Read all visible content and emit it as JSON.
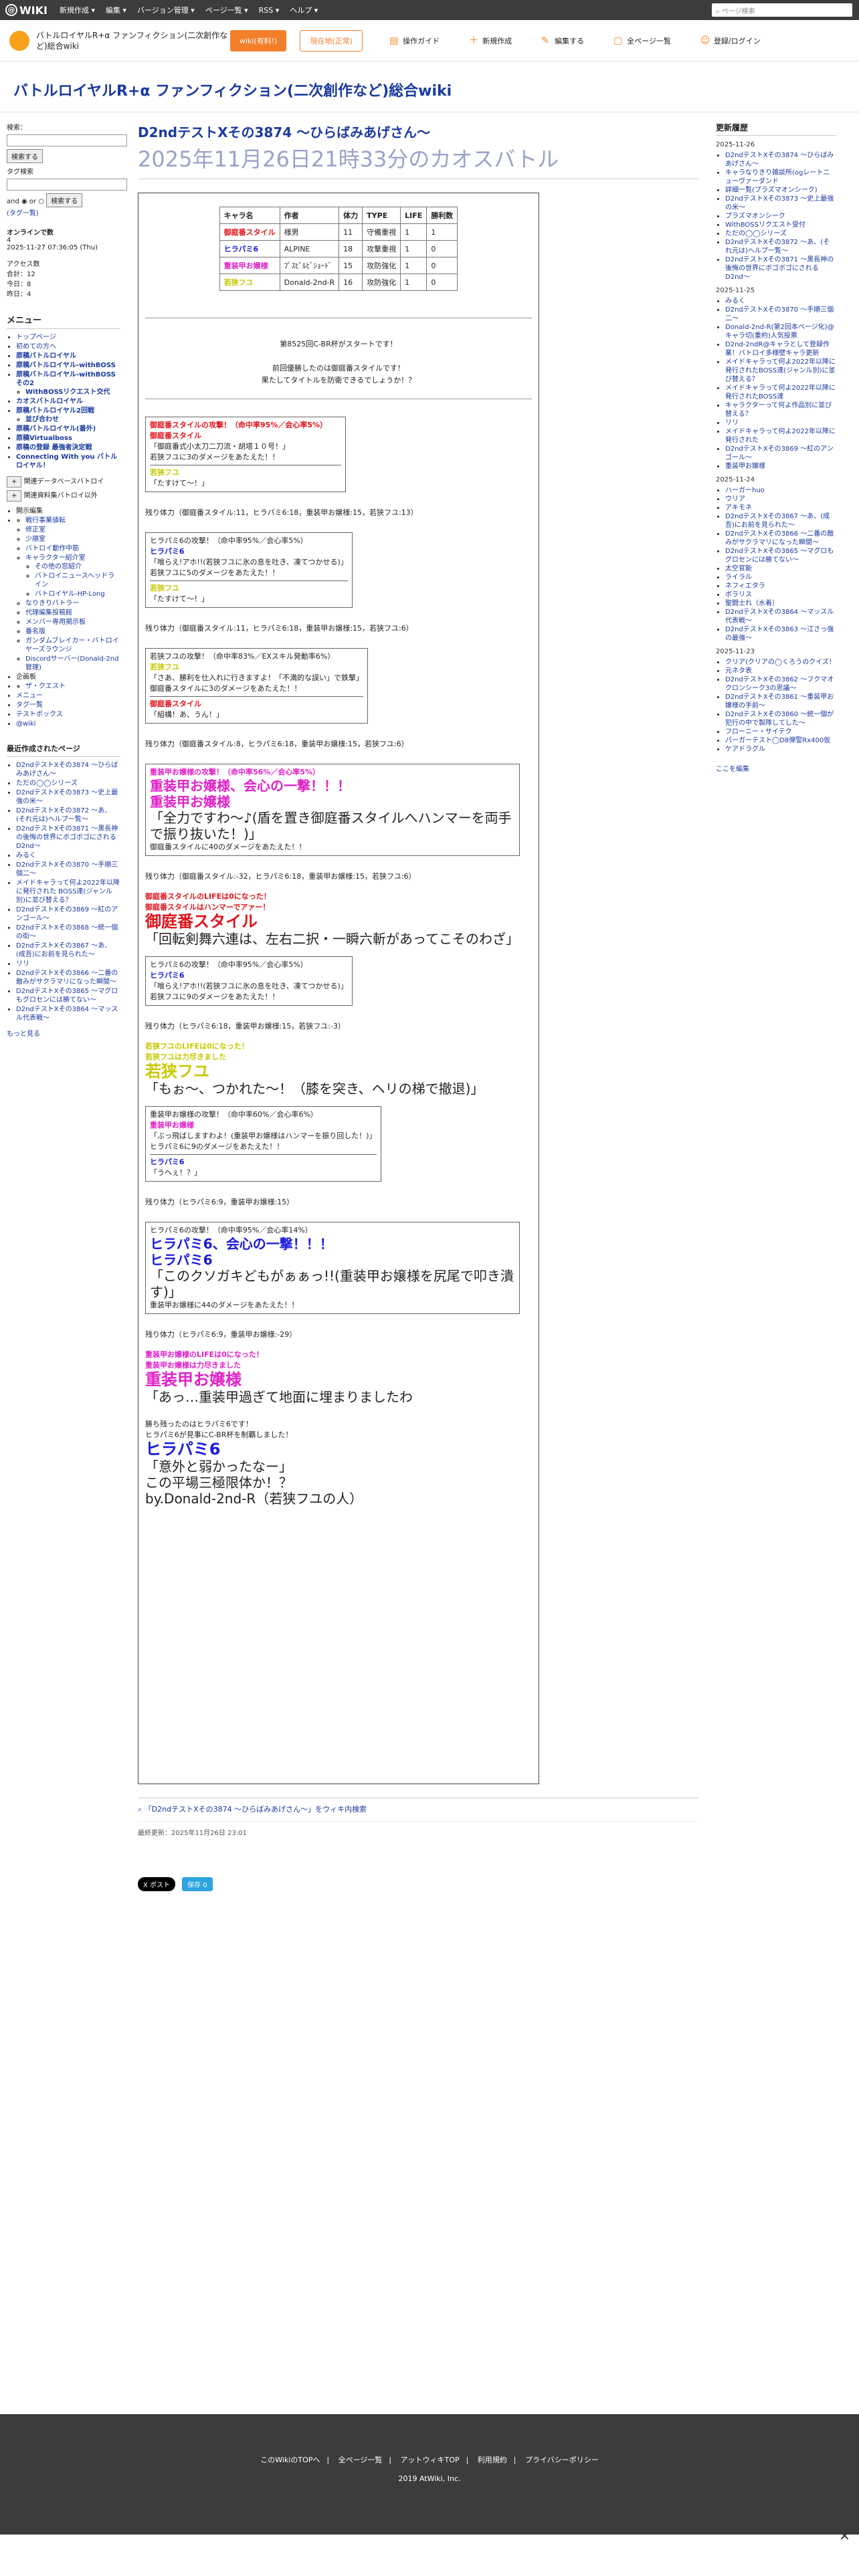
{
  "topbar": {
    "logo": "WIKI",
    "menus": [
      "新規作成 ▾",
      "編集 ▾",
      "バージョン管理 ▾",
      "ページ一覧 ▾",
      "RSS ▾",
      "ヘルプ ▾"
    ],
    "search_placeholder": "ページ検索"
  },
  "header": {
    "wiki_name": "バトルロイヤルR+α ファンフィクション(二次創作など)総合wiki",
    "btn_pro": "wiki(有料!)",
    "btn_free": "現在地(正常)",
    "nav": [
      "操作ガイド",
      "新規作成",
      "編集する",
      "全ページ一覧",
      "登録/ログイン"
    ]
  },
  "site_title": "バトルロイヤルR+α ファンフィクション(二次創作など)総合wiki",
  "left": {
    "search_label": "検索：",
    "search_btn": "検索する",
    "tag_label": "タグ検索",
    "tag_btn": "検索する",
    "and": "and",
    "or": "or",
    "tag_list": "(タグ一覧)",
    "online": "オンラインで数",
    "online_count": "4",
    "date": "2025-11-27 07:36:05 (Thu)",
    "counts": [
      "アクセス数",
      "合計：12",
      "今日：8",
      "昨日：4"
    ],
    "menu_head": "メニュー",
    "menu": [
      "トップページ",
      "初めての方へ",
      "原稿バトルロイヤル",
      "原稿バトルロイヤル-withBOSS",
      "原稿バトルロイヤル-withBOSS その2",
      "WithBOSSリクエスト交代",
      "カオスバトルロイヤル",
      "原稿バトルロイヤル2回戦",
      "並び合わせ",
      "原稿バトルロイヤル(番外)",
      "原稿Virtualboss",
      "原稿の登録 最強者決定戦",
      "Connecting With you バトルロイヤル！"
    ],
    "sub": [
      "関連データベースバトロイ",
      "関連資料集バトロイ以外"
    ],
    "edit_head": "開示編集",
    "edit": [
      "戦行事業値転",
      "修正室",
      "少順室",
      "バトロイ動作中筋",
      "キャラクター紹介室",
      "その他の窓紹介",
      "バトロイニュースヘッドライン",
      "バトロイヤル-HP-Long",
      "なりきりバトラー",
      "代理編集投稿館",
      "メンバー専用掲示板",
      "番名版",
      "ガンダムブレイカー・バトロイヤーズラウンジ",
      "Discordサーバー(Donald-2nd管理)"
    ],
    "other": [
      "企画板",
      "ザ・クエスト",
      "メニュー",
      "タグ一覧",
      "テストボックス",
      "@wiki"
    ],
    "recent_head": "最近作成されたページ",
    "recent": [
      "D2ndテストXその3874 〜ひらばみあげさん〜",
      "ただの◯◯シリーズ",
      "D2ndテストXその3873 〜史上最強の米〜",
      "D2ndテストXその3872 〜あ、(それ元は)ヘルプ一覧〜",
      "D2ndテストXその3871 〜黒長神の後悔の世界にボゴボゴにされる D2nd〜",
      "みるく",
      "D2ndテストXその3870 〜手順三個二〜",
      "メイドキャラって何よ2022年以降に発行された BOSS達(ジャンル別)に並び替える？",
      "D2ndテストXその3869 〜紅のアンゴール〜",
      "D2ndテストXその3868 〜統一個の街〜",
      "D2ndテストXその3867 〜あ、(成吾)にお前を見られた〜",
      "リリ",
      "D2ndテストXその3866 〜二番の敵みがサクラマリになった瞬間〜",
      "D2ndテストXその3865 〜マグロもグロセンには勝てない〜",
      "D2ndテストXその3864 〜マッスル代表戦〜"
    ],
    "more": "もっと見る"
  },
  "main": {
    "title": "D2ndテストXその3874 〜ひらばみあげさん〜",
    "subtitle": "2025年11月26日21時33分のカオスバトル",
    "table": {
      "headers": [
        "キャラ名",
        "作者",
        "体力",
        "TYPE",
        "LIFE",
        "勝利数"
      ],
      "rows": [
        [
          "御庭番スタイル",
          "様男",
          "11",
          "守備重視",
          "1",
          "1"
        ],
        [
          "ヒラパミ6",
          "ALPINE",
          "18",
          "攻撃重視",
          "1",
          "0"
        ],
        [
          "重装甲お嬢様",
          "ﾌﾟｽﾋﾟﾙﾋﾞｼｮｰﾄﾞ",
          "15",
          "攻防強化",
          "1",
          "0"
        ],
        [
          "若狭フユ",
          "Donald-2nd-R",
          "16",
          "攻防強化",
          "1",
          "0"
        ]
      ]
    },
    "intro1": "第8525回C-BR杯がスタートです！",
    "intro2": "前回優勝したのは御庭番スタイルです！",
    "intro3": "果たしてタイトルを防衛できるでしょうか！？",
    "b1": [
      "御庭番スタイルの攻撃！（命中率95%／会心率5%）",
      "御庭番スタイル",
      "「御庭番式小太刀二刀流・胡塔１０号！」",
      "若狭フユに3のダメージをあたえた！！",
      "若狭フユ",
      "「たすけて〜！」"
    ],
    "r1": "残り体力（御庭番スタイル:11，ヒラパミ6:18，重装甲お嬢様:15，若狭フユ:13）",
    "b2": [
      "ヒラパミ6の攻撃！（命中率95%／会心率5%）",
      "ヒラパミ6",
      "「喰らえ!アホ!!(若狭フユに氷の息を吐き、凍てつかせる)」",
      "若狭フユに5のダメージをあたえた！！",
      "若狭フユ",
      "「たすけて〜！」"
    ],
    "r2": "残り体力（御庭番スタイル:11，ヒラパミ6:18，重装甲お嬢様:15，若狭フユ:6）",
    "b3": [
      "若狭フユの攻撃！（命中率83%／EXスキル発動率6%）",
      "若狭フユ",
      "「さあ、勝利を仕入れに行きますよ！「不満的な誤い」で鉄撃」",
      "御庭番スタイルに3のダメージをあたえた！！",
      "御庭番スタイル",
      "「組構！あ、うん！」"
    ],
    "r3": "残り体力（御庭番スタイル:8，ヒラパミ6:18，重装甲お嬢様:15，若狭フユ:6）",
    "b4": [
      "重装甲お嬢様の攻撃！（命中率56%／会心率5%）",
      "重装甲お嬢様、会心の一撃！！！",
      "重装甲お嬢様",
      "「全力ですわ〜♪(盾を置き御庭番スタイルへハンマーを両手で振り抜いた！)」",
      "御庭番スタイルに40のダメージをあたえた！！"
    ],
    "r4": "残り体力（御庭番スタイル:-32，ヒラパミ6:18，重装甲お嬢様:15，若狭フユ:6）",
    "d1": [
      "御庭番スタイルのLIFEは0になった！",
      "御庭番スタイルはハンマーでアァー！",
      "御庭番スタイル",
      "「回転剣舞六連は、左右二択・一瞬六斬があってこそのわざ」"
    ],
    "b5": [
      "ヒラパミ6の攻撃！（命中率95%／会心率5%）",
      "ヒラパミ6",
      "「喰らえ!アホ!!(若狭フユに氷の息を吐き、凍てつかせる)」",
      "若狭フユに9のダメージをあたえた！！"
    ],
    "r5": "残り体力（ヒラパミ6:18，重装甲お嬢様:15，若狭フユ:-3）",
    "d2": [
      "若狭フユのLIFEは0になった！",
      "若狭フユは力尽きました",
      "若狭フユ",
      "「もぉ〜、つかれた〜！（膝を突き、ヘリの梯で撤退)」"
    ],
    "b6": [
      "重装甲お嬢様の攻撃！（命中率60%／会心率6%）",
      "重装甲お嬢様",
      "「ぶっ飛ばしますわよ！(重装甲お嬢様はハンマーを振り回した！)」",
      "ヒラパミ6に9のダメージをあたえた！！",
      "ヒラパミ6",
      "「うへぇ！？」"
    ],
    "r6": "残り体力（ヒラパミ6:9，重装甲お嬢様:15）",
    "b7": [
      "ヒラパミ6の攻撃！（命中率95%／会心率14%）",
      "ヒラパミ6、会心の一撃！！！",
      "ヒラパミ6",
      "「このクソガキどもがぁぁっ!!(重装甲お嬢様を尻尾で叩き潰す)」",
      "重装甲お嬢様に44のダメージをあたえた！！"
    ],
    "r7": "残り体力（ヒラパミ6:9，重装甲お嬢様:-29）",
    "d3": [
      "重装甲お嬢様のLIFEは0になった！",
      "重装甲お嬢様は力尽きました",
      "重装甲お嬢様",
      "「あっ…重装甲過ぎて地面に埋まりましたわ"
    ],
    "win": [
      "勝ち残ったのはヒラパミ6です！",
      "ヒラパミ6が見事にC-BR杯を制覇しました！",
      "ヒラパミ6",
      "「意外と弱かったなー」",
      "この平場三極限体か！？",
      "by.Donald-2nd-R（若狭フユの人）"
    ],
    "wikilink": "「D2ndテストXその3874 〜ひらばみあげさん〜」をウィキ内検索",
    "updated": "最終更新：2025年11月26日 23:01",
    "share": [
      "X ポスト",
      "保存 0"
    ]
  },
  "right": {
    "head": "更新履歴",
    "groups": [
      {
        "date": "2025-11-26",
        "items": [
          "D2ndテストXその3874 〜ひらばみあげさん〜",
          "キャラなりきり雑談所(ogレートニューヴァーダンド",
          "詳細一覧(プラズマオンシーク)",
          "D2ndテストXその3873 〜史上最強の米〜",
          "プラズマオンシーク",
          "WithBOSSリクエスト受付",
          "ただの◯◯シリーズ",
          "D2ndテストXその3872 〜あ、(それ元は)ヘルプ一覧〜",
          "D2ndテストXその3871 〜黒長神の後悔の世界にボゴボゴにされる D2nd〜"
        ]
      },
      {
        "date": "2025-11-25",
        "items": [
          "みるく",
          "D2ndテストXその3870 〜手順三個二〜",
          "Donald-2nd-R(第2回本ページ化)@キャラ切(重約)人気投票",
          "D2nd-2ndR@キャラとして登録作業！バトロイ多様壁キャラ更新",
          "メイドキャラって何よ2022年以降に発行されたBOSS達(ジャンル別)に並び替える？",
          "メイドキャラって何よ2022年以降に発行されたBOSS達",
          "キャラクターって何よ作品別に並び替える？",
          "リリ",
          "メイドキャラって何よ2022年以降に発行された",
          "D2ndテストXその3869 〜紅のアンゴール〜",
          "重装甲お嬢様"
        ]
      },
      {
        "date": "2025-11-24",
        "items": [
          "ハーガーhuo",
          "ウリア",
          "アキモネ",
          "D2ndテストXその3867 〜あ、(成吾)にお前を見られた〜",
          "D2ndテストXその3866 〜二番の敵みがサクラマリになった瞬間〜",
          "D2ndテストXその3865 〜マグロもグロセンには勝てない〜",
          "太空官能",
          "ライラル",
          "ネフィエタラ",
          "ボラリス",
          "聖闘士れ（水着）",
          "D2ndテストXその3864 〜マッスル代表戦〜",
          "D2ndテストXその3863 〜江さっ強の最強〜"
        ]
      },
      {
        "date": "2025-11-23",
        "items": [
          "クリア(クリアの◯くろうのクイズ！",
          "元ネタ表",
          "D2ndテストXその3862 〜フクマオクロンシーク3の思議〜",
          "D2ndテストXその3861 〜重装甲お嬢様の手前〜",
          "D2ndテストXその3860 〜統一個が犯行の中で製隊してした〜",
          "フローニー・サイテク",
          "パーガーテスト◯D8弾警Rx400仮",
          "ケアドラグル"
        ]
      }
    ],
    "edit_here": "ここを編集"
  },
  "footer": {
    "links": [
      "このWikiのTOPへ",
      "全ページ一覧",
      "アットウィキTOP",
      "利用規約",
      "プライバシーポリシー"
    ],
    "copyright": "2019 AtWiki, Inc."
  }
}
